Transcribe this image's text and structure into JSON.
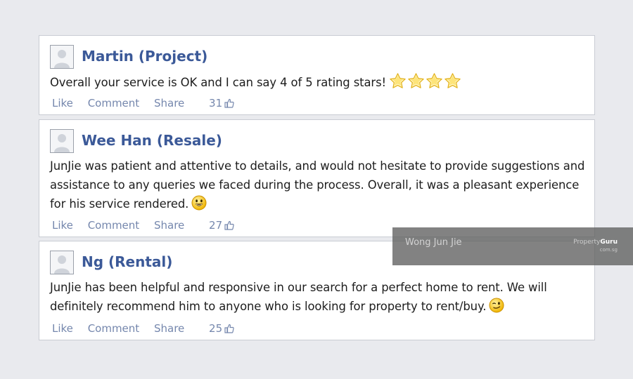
{
  "reviews": [
    {
      "name": "Martin (Project)",
      "text": "Overall your service is OK and I can say 4 of 5 rating stars!",
      "rating_stars_shown": 4,
      "trailing_icon": "star-icon",
      "actions": {
        "like": "Like",
        "comment": "Comment",
        "share": "Share"
      },
      "likes": "31"
    },
    {
      "name": "Wee Han (Resale)",
      "text": "JunJie was patient and attentive to details, and would not hesitate to provide suggestions and assistance to any queries we faced during the process. Overall, it was a pleasant experience for his service rendered.",
      "trailing_icon": "smiley-icon",
      "actions": {
        "like": "Like",
        "comment": "Comment",
        "share": "Share"
      },
      "likes": "27"
    },
    {
      "name": "Ng (Rental)",
      "text": "JunJie has been helpful and responsive in our search for a perfect home to rent. We will definitely recommend him to anyone who is looking for property to rent/buy.",
      "trailing_icon": "wink-icon",
      "actions": {
        "like": "Like",
        "comment": "Comment",
        "share": "Share"
      },
      "likes": "25"
    }
  ],
  "watermark": {
    "agent_name": "Wong Jun Jie",
    "brand_prefix": "Property",
    "brand_suffix": "Guru",
    "domain": "com.sg"
  },
  "colors": {
    "name_blue": "#3b5998",
    "action_blue": "#7587ad",
    "background": "#e9eaee",
    "star_gold": "#f5c518"
  }
}
